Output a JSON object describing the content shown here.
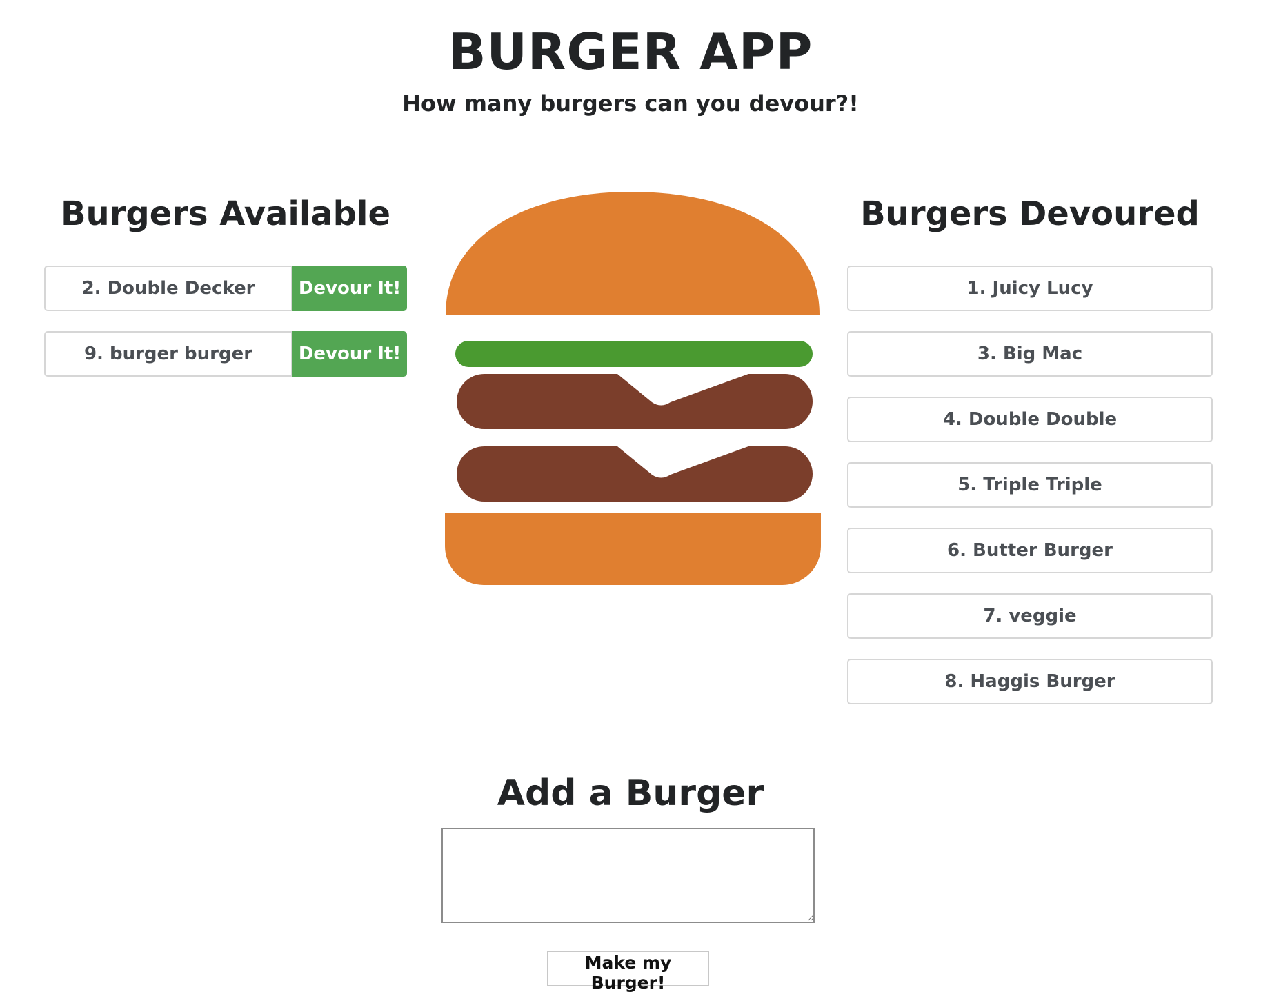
{
  "header": {
    "title": "BURGER APP",
    "subtitle": "How many burgers can you devour?!"
  },
  "available": {
    "heading": "Burgers Available",
    "items": [
      {
        "name": "2. Double Decker",
        "button_label": "Devour It!"
      },
      {
        "name": "9. burger burger",
        "button_label": "Devour It!"
      }
    ]
  },
  "devoured": {
    "heading": "Burgers Devoured",
    "items": [
      "1. Juicy Lucy",
      "3. Big Mac",
      "4. Double Double",
      "5. Triple Triple",
      "6. Butter Burger",
      "7. veggie",
      "8. Haggis Burger"
    ]
  },
  "add_form": {
    "heading": "Add a Burger",
    "textarea_value": "",
    "submit_label": "Make my Burger!"
  },
  "colors": {
    "bun": "#e07f30",
    "lettuce": "#4a9a30",
    "patty": "#7b3e2b",
    "devour_button": "#53a653"
  },
  "icons": {
    "burger_illustration": "burger-icon"
  }
}
